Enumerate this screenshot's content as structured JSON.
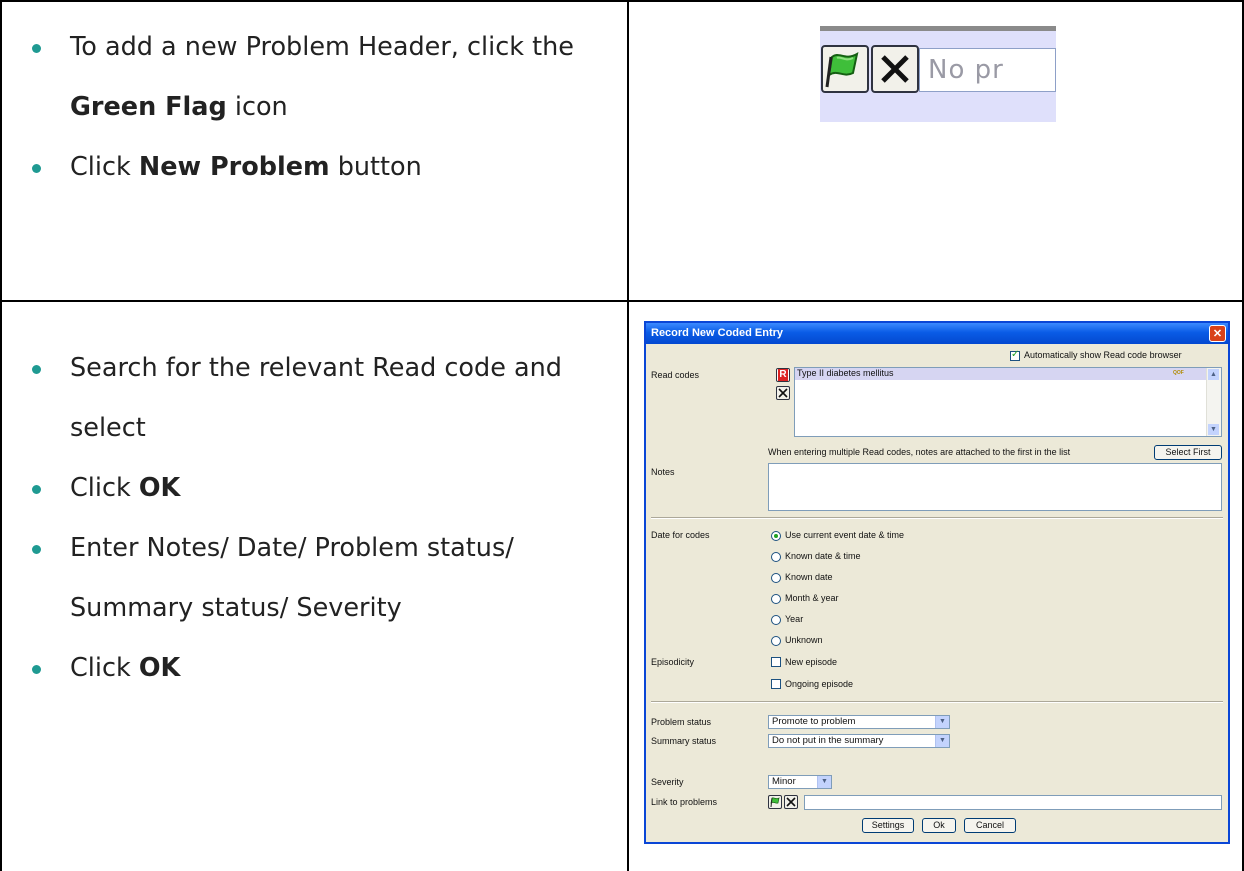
{
  "instructions_top": {
    "item1_pre": "To add a new Problem Header, click the ",
    "item1_bold": "Green Flag",
    "item1_post": " icon",
    "item2_pre": "Click ",
    "item2_bold": "New Problem",
    "item2_post": " button"
  },
  "instructions_bottom": {
    "item1": "Search for the relevant Read code and select",
    "item2_pre": "Click ",
    "item2_bold": "OK",
    "item3": "Enter Notes/ Date/ Problem status/ Summary status/ Severity",
    "item4_pre": "Click ",
    "item4_bold": "OK"
  },
  "toolbar_crop": {
    "input_value": "No pr",
    "icons": [
      "green-flag-icon",
      "delete-x-icon"
    ]
  },
  "dialog": {
    "title": "Record New Coded Entry",
    "auto_show_label": "Automatically show Read code browser",
    "read_codes_label": "Read codes",
    "read_code_entry": "Type II diabetes mellitus",
    "qof_badge": "QOF",
    "multi_code_note": "When entering multiple Read codes, notes are attached to the first in the list",
    "select_first_label": "Select First",
    "notes_label": "Notes",
    "date_label": "Date for codes",
    "date_options": [
      "Use current event date & time",
      "Known date & time",
      "Known date",
      "Month & year",
      "Year",
      "Unknown"
    ],
    "episodicity_label": "Episodicity",
    "episode_options": [
      "New episode",
      "Ongoing episode"
    ],
    "problem_status_label": "Problem status",
    "problem_status_value": "Promote to problem",
    "summary_status_label": "Summary status",
    "summary_status_value": "Do not put in the summary",
    "severity_label": "Severity",
    "severity_value": "Minor",
    "link_label": "Link to problems",
    "buttons": {
      "settings": "Settings",
      "ok": "Ok",
      "cancel": "Cancel"
    }
  }
}
